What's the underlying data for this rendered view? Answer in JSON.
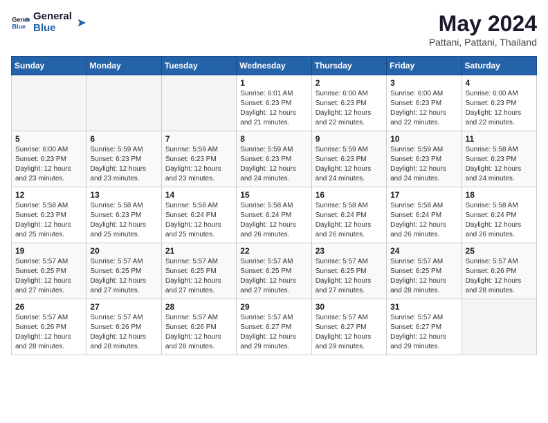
{
  "logo": {
    "text_general": "General",
    "text_blue": "Blue"
  },
  "title": {
    "month_year": "May 2024",
    "location": "Pattani, Pattani, Thailand"
  },
  "weekdays": [
    "Sunday",
    "Monday",
    "Tuesday",
    "Wednesday",
    "Thursday",
    "Friday",
    "Saturday"
  ],
  "weeks": [
    [
      {
        "day": "",
        "info": ""
      },
      {
        "day": "",
        "info": ""
      },
      {
        "day": "",
        "info": ""
      },
      {
        "day": "1",
        "info": "Sunrise: 6:01 AM\nSunset: 6:23 PM\nDaylight: 12 hours\nand 21 minutes."
      },
      {
        "day": "2",
        "info": "Sunrise: 6:00 AM\nSunset: 6:23 PM\nDaylight: 12 hours\nand 22 minutes."
      },
      {
        "day": "3",
        "info": "Sunrise: 6:00 AM\nSunset: 6:23 PM\nDaylight: 12 hours\nand 22 minutes."
      },
      {
        "day": "4",
        "info": "Sunrise: 6:00 AM\nSunset: 6:23 PM\nDaylight: 12 hours\nand 22 minutes."
      }
    ],
    [
      {
        "day": "5",
        "info": "Sunrise: 6:00 AM\nSunset: 6:23 PM\nDaylight: 12 hours\nand 23 minutes."
      },
      {
        "day": "6",
        "info": "Sunrise: 5:59 AM\nSunset: 6:23 PM\nDaylight: 12 hours\nand 23 minutes."
      },
      {
        "day": "7",
        "info": "Sunrise: 5:59 AM\nSunset: 6:23 PM\nDaylight: 12 hours\nand 23 minutes."
      },
      {
        "day": "8",
        "info": "Sunrise: 5:59 AM\nSunset: 6:23 PM\nDaylight: 12 hours\nand 24 minutes."
      },
      {
        "day": "9",
        "info": "Sunrise: 5:59 AM\nSunset: 6:23 PM\nDaylight: 12 hours\nand 24 minutes."
      },
      {
        "day": "10",
        "info": "Sunrise: 5:59 AM\nSunset: 6:23 PM\nDaylight: 12 hours\nand 24 minutes."
      },
      {
        "day": "11",
        "info": "Sunrise: 5:58 AM\nSunset: 6:23 PM\nDaylight: 12 hours\nand 24 minutes."
      }
    ],
    [
      {
        "day": "12",
        "info": "Sunrise: 5:58 AM\nSunset: 6:23 PM\nDaylight: 12 hours\nand 25 minutes."
      },
      {
        "day": "13",
        "info": "Sunrise: 5:58 AM\nSunset: 6:23 PM\nDaylight: 12 hours\nand 25 minutes."
      },
      {
        "day": "14",
        "info": "Sunrise: 5:58 AM\nSunset: 6:24 PM\nDaylight: 12 hours\nand 25 minutes."
      },
      {
        "day": "15",
        "info": "Sunrise: 5:58 AM\nSunset: 6:24 PM\nDaylight: 12 hours\nand 26 minutes."
      },
      {
        "day": "16",
        "info": "Sunrise: 5:58 AM\nSunset: 6:24 PM\nDaylight: 12 hours\nand 26 minutes."
      },
      {
        "day": "17",
        "info": "Sunrise: 5:58 AM\nSunset: 6:24 PM\nDaylight: 12 hours\nand 26 minutes."
      },
      {
        "day": "18",
        "info": "Sunrise: 5:58 AM\nSunset: 6:24 PM\nDaylight: 12 hours\nand 26 minutes."
      }
    ],
    [
      {
        "day": "19",
        "info": "Sunrise: 5:57 AM\nSunset: 6:25 PM\nDaylight: 12 hours\nand 27 minutes."
      },
      {
        "day": "20",
        "info": "Sunrise: 5:57 AM\nSunset: 6:25 PM\nDaylight: 12 hours\nand 27 minutes."
      },
      {
        "day": "21",
        "info": "Sunrise: 5:57 AM\nSunset: 6:25 PM\nDaylight: 12 hours\nand 27 minutes."
      },
      {
        "day": "22",
        "info": "Sunrise: 5:57 AM\nSunset: 6:25 PM\nDaylight: 12 hours\nand 27 minutes."
      },
      {
        "day": "23",
        "info": "Sunrise: 5:57 AM\nSunset: 6:25 PM\nDaylight: 12 hours\nand 27 minutes."
      },
      {
        "day": "24",
        "info": "Sunrise: 5:57 AM\nSunset: 6:25 PM\nDaylight: 12 hours\nand 28 minutes."
      },
      {
        "day": "25",
        "info": "Sunrise: 5:57 AM\nSunset: 6:26 PM\nDaylight: 12 hours\nand 28 minutes."
      }
    ],
    [
      {
        "day": "26",
        "info": "Sunrise: 5:57 AM\nSunset: 6:26 PM\nDaylight: 12 hours\nand 28 minutes."
      },
      {
        "day": "27",
        "info": "Sunrise: 5:57 AM\nSunset: 6:26 PM\nDaylight: 12 hours\nand 28 minutes."
      },
      {
        "day": "28",
        "info": "Sunrise: 5:57 AM\nSunset: 6:26 PM\nDaylight: 12 hours\nand 28 minutes."
      },
      {
        "day": "29",
        "info": "Sunrise: 5:57 AM\nSunset: 6:27 PM\nDaylight: 12 hours\nand 29 minutes."
      },
      {
        "day": "30",
        "info": "Sunrise: 5:57 AM\nSunset: 6:27 PM\nDaylight: 12 hours\nand 29 minutes."
      },
      {
        "day": "31",
        "info": "Sunrise: 5:57 AM\nSunset: 6:27 PM\nDaylight: 12 hours\nand 29 minutes."
      },
      {
        "day": "",
        "info": ""
      }
    ]
  ]
}
